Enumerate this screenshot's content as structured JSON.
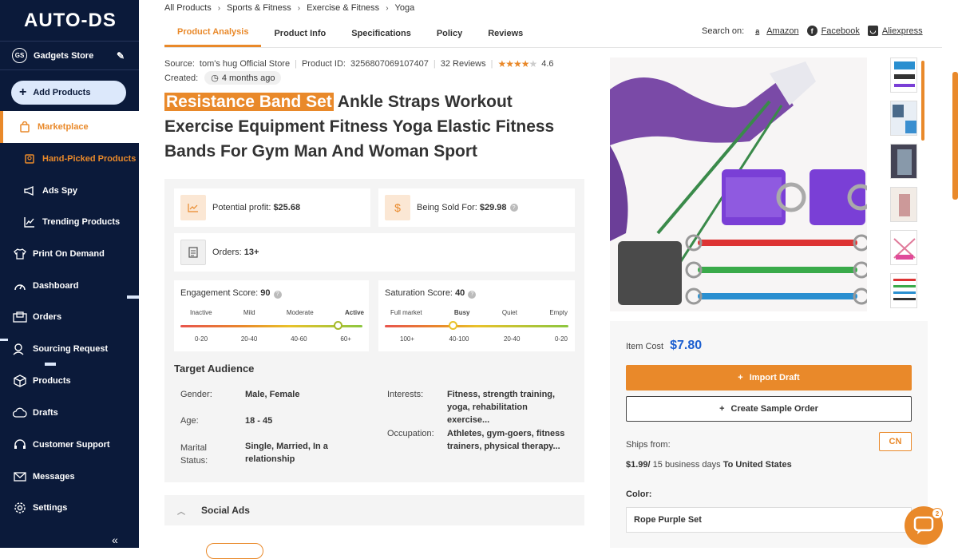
{
  "brand": {
    "logo_text": "AUTO-DS"
  },
  "store": {
    "initials": "GS",
    "name": "Gadgets Store"
  },
  "sidebar": {
    "add_products": "Add Products",
    "items": [
      {
        "label": "Marketplace",
        "icon": "bag-icon"
      },
      {
        "label": "Hand-Picked Products",
        "icon": "award-icon"
      },
      {
        "label": "Ads Spy",
        "icon": "megaphone-icon"
      },
      {
        "label": "Trending Products",
        "icon": "trend-icon"
      },
      {
        "label": "Print On Demand",
        "icon": "shirt-icon"
      },
      {
        "label": "Dashboard",
        "icon": "gauge-icon"
      },
      {
        "label": "Orders",
        "icon": "orders-icon"
      },
      {
        "label": "Sourcing Request",
        "icon": "sourcing-icon"
      },
      {
        "label": "Products",
        "icon": "box-icon"
      },
      {
        "label": "Drafts",
        "icon": "cloud-icon"
      },
      {
        "label": "Customer Support",
        "icon": "headset-icon"
      },
      {
        "label": "Messages",
        "icon": "mail-icon"
      },
      {
        "label": "Settings",
        "icon": "gear-icon"
      }
    ],
    "collapse": "«"
  },
  "breadcrumbs": [
    "All Products",
    "Sports & Fitness",
    "Exercise & Fitness",
    "Yoga"
  ],
  "tabs": [
    "Product Analysis",
    "Product Info",
    "Specifications",
    "Policy",
    "Reviews"
  ],
  "search_on": {
    "label": "Search on:",
    "links": [
      "Amazon",
      "Facebook",
      "Aliexpress"
    ]
  },
  "product": {
    "source_label": "Source:",
    "source": "tom's hug Official Store",
    "id_label": "Product ID:",
    "id": "3256807069107407",
    "reviews": "32 Reviews",
    "rating": "4.6",
    "rating_value": 4.6,
    "created_label": "Created:",
    "created": "4 months ago",
    "title_highlight": "Resistance Band Set",
    "title_rest": " Ankle Straps Workout Exercise Equipment Fitness Yoga Elastic Fitness Bands For Gym Man And Woman Sport"
  },
  "stats": {
    "profit_label": "Potential profit:",
    "profit": "$25.68",
    "sold_label": "Being Sold For:",
    "sold": "$29.98",
    "orders_label": "Orders:",
    "orders": "13+"
  },
  "engagement": {
    "label": "Engagement Score:",
    "score": "90",
    "levels": [
      "Inactive",
      "Mild",
      "Moderate",
      "Active"
    ],
    "ranges": [
      "0-20",
      "20-40",
      "40-60",
      "60+"
    ],
    "active_index": 3
  },
  "saturation": {
    "label": "Saturation Score:",
    "score": "40",
    "levels": [
      "Full market",
      "Busy",
      "Quiet",
      "Empty"
    ],
    "ranges": [
      "100+",
      "40-100",
      "20-40",
      "0-20"
    ],
    "active_index": 1
  },
  "audience": {
    "title": "Target Audience",
    "gender_label": "Gender:",
    "gender": "Male, Female",
    "age_label": "Age:",
    "age": "18 - 45",
    "marital_label": "Marital Status:",
    "marital": "Single, Married, In a relationship",
    "interests_label": "Interests:",
    "interests": "Fitness, strength training, yoga, rehabilitation exercise...",
    "occupation_label": "Occupation:",
    "occupation": "Athletes, gym-goers, fitness trainers, physical therapy..."
  },
  "social_ads": "Social Ads",
  "buy": {
    "item_cost_label": "Item Cost",
    "item_cost": "$7.80",
    "import_draft": "Import Draft",
    "create_sample": "Create Sample Order",
    "ships_from_label": "Ships from:",
    "ships_from": "CN",
    "shipping_price": "$1.99/",
    "shipping_days": " 15 business days ",
    "shipping_dest": "To United States",
    "color_label": "Color:",
    "color_value": "Rope Purple Set"
  },
  "chat": {
    "badge": "2"
  },
  "colors": {
    "accent": "#e9892a",
    "sidebar": "#0b1a3a",
    "price": "#1c5fd0"
  }
}
